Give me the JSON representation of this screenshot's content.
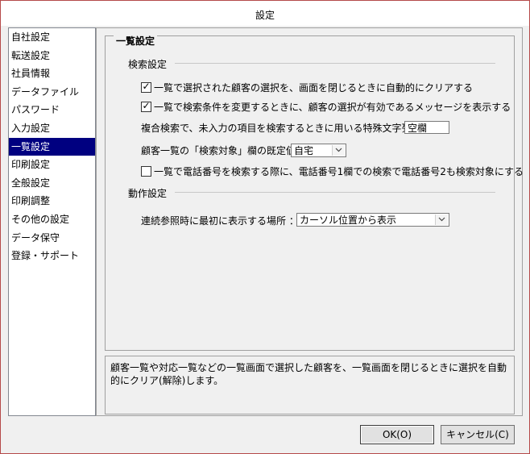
{
  "window": {
    "title": "設定"
  },
  "sidebar": {
    "items": [
      {
        "label": "自社設定"
      },
      {
        "label": "転送設定"
      },
      {
        "label": "社員情報"
      },
      {
        "label": "データファイル"
      },
      {
        "label": "パスワード"
      },
      {
        "label": "入力設定"
      },
      {
        "label": "一覧設定",
        "selected": true
      },
      {
        "label": "印刷設定"
      },
      {
        "label": "全般設定"
      },
      {
        "label": "印刷調整"
      },
      {
        "label": "その他の設定"
      },
      {
        "label": "データ保守"
      },
      {
        "label": "登録・サポート"
      }
    ]
  },
  "main": {
    "title": "一覧設定",
    "search": {
      "title": "検索設定",
      "option1": {
        "label": "一覧で選択された顧客の選択を、画面を閉じるときに自動的にクリアする",
        "checked": true
      },
      "option2": {
        "label": "一覧で検索条件を変更するときに、顧客の選択が有効であるメッセージを表示する",
        "checked": true
      },
      "special_char_label": "複合検索で、未入力の項目を検索するときに用いる特殊文字列:",
      "special_char_value": "空欄",
      "target_label": "顧客一覧の「検索対象」欄の既定値:",
      "target_value": "自宅",
      "option3": {
        "label": "一覧で電話番号を検索する際に、電話番号1欄での検索で電話番号2も検索対象にする",
        "checked": false
      }
    },
    "action": {
      "title": "動作設定",
      "location_label": "連続参照時に最初に表示する場所 ：",
      "location_value": "カーソル位置から表示"
    }
  },
  "description": "顧客一覧や対応一覧などの一覧画面で選択した顧客を、一覧画面を閉じるときに選択を自動的にクリア(解除)します。",
  "footer": {
    "ok_label": "OK(O)",
    "cancel_label": "キャンセル(C)"
  }
}
